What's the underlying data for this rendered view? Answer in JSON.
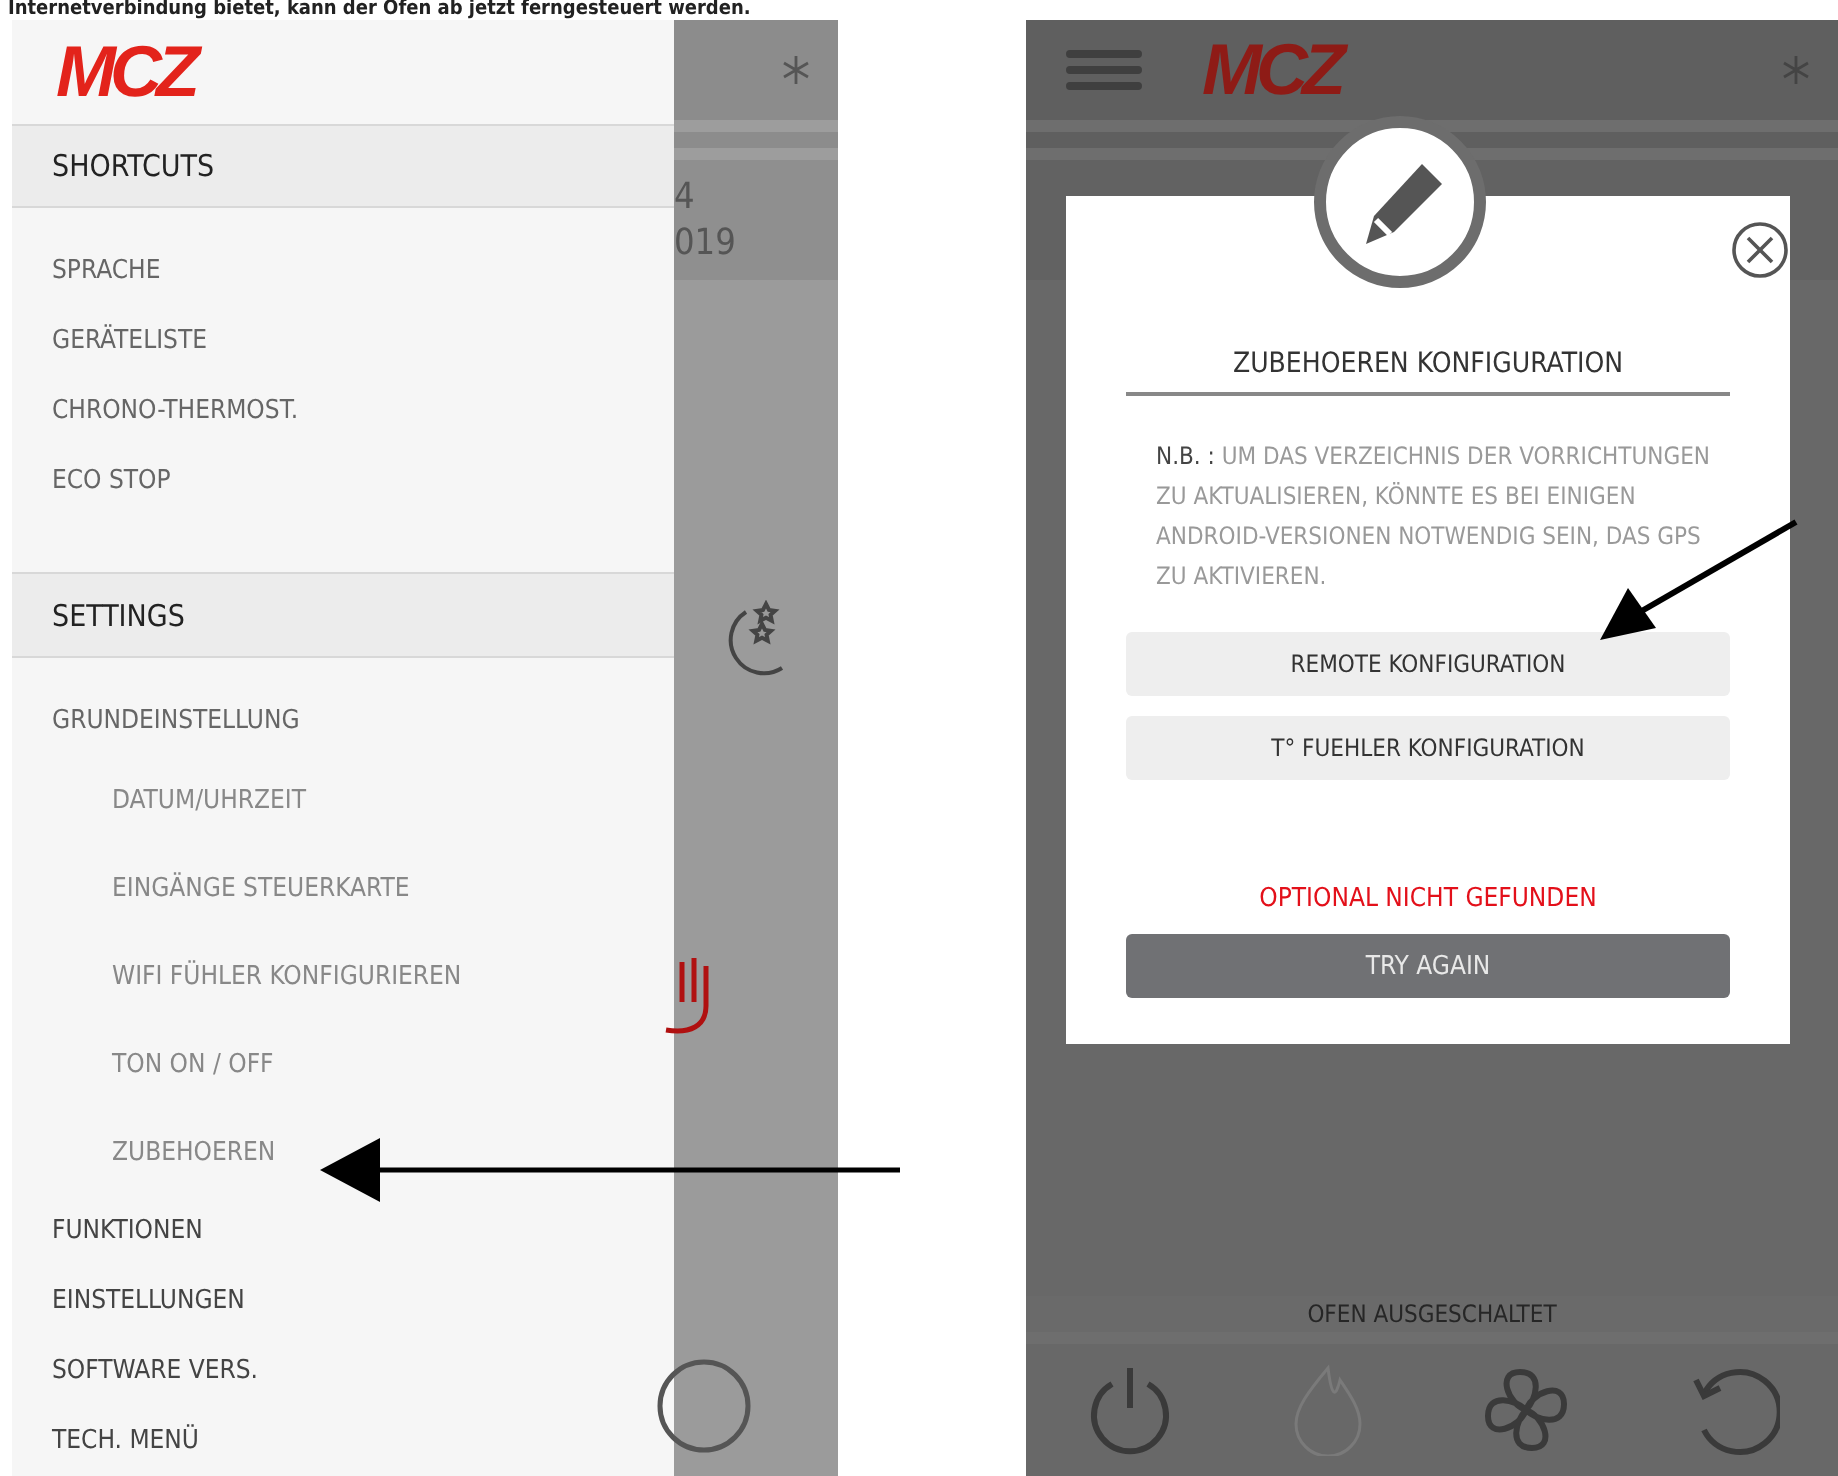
{
  "caption": "Internetverbindung bietet, kann der Ofen ab jetzt ferngesteuert werden.",
  "drawer": {
    "logo": "MCZ",
    "sections": [
      {
        "title": "SHORTCUTS",
        "items": [
          {
            "label": "SPRACHE",
            "kind": "item"
          },
          {
            "label": "GERÄTELISTE",
            "kind": "item"
          },
          {
            "label": "CHRONO-THERMOST.",
            "kind": "item"
          },
          {
            "label": "ECO STOP",
            "kind": "item"
          }
        ]
      },
      {
        "title": "SETTINGS",
        "items": [
          {
            "label": "GRUNDEINSTELLUNG",
            "kind": "item"
          },
          {
            "label": "DATUM/UHRZEIT",
            "kind": "subitem"
          },
          {
            "label": "EINGÄNGE STEUERKARTE",
            "kind": "subitem"
          },
          {
            "label": "WIFI FÜHLER KONFIGURIEREN",
            "kind": "subitem"
          },
          {
            "label": "TON ON / OFF",
            "kind": "subitem"
          },
          {
            "label": "ZUBEHOEREN",
            "kind": "subitem"
          },
          {
            "label": "FUNKTIONEN",
            "kind": "group"
          },
          {
            "label": "EINSTELLUNGEN",
            "kind": "group"
          },
          {
            "label": "SOFTWARE VERS.",
            "kind": "group"
          },
          {
            "label": "TECH. MENÜ",
            "kind": "group"
          }
        ]
      }
    ]
  },
  "left_background": {
    "date_fragments": [
      "4",
      "019"
    ]
  },
  "right_screen": {
    "logo": "MCZ",
    "status": "OFEN AUSGESCHALTET"
  },
  "dialog": {
    "title": "ZUBEHOEREN KONFIGURATION",
    "note": "**N.B. :** UM DAS VERZEICHNIS DER VORRICHTUNGEN ZU AKTUALISIEREN, KÖNNTE ES BEI EINIGEN ANDROID-VERSIONEN NOTWENDIG SEIN, DAS GPS ZU AKTIVIEREN.",
    "buttons": [
      {
        "label": "REMOTE KONFIGURATION",
        "kind": "option"
      },
      {
        "label": "T° FUEHLER KONFIGURATION",
        "kind": "option"
      }
    ],
    "error": "OPTIONAL NICHT GEFUNDEN",
    "retry": "TRY AGAIN"
  }
}
